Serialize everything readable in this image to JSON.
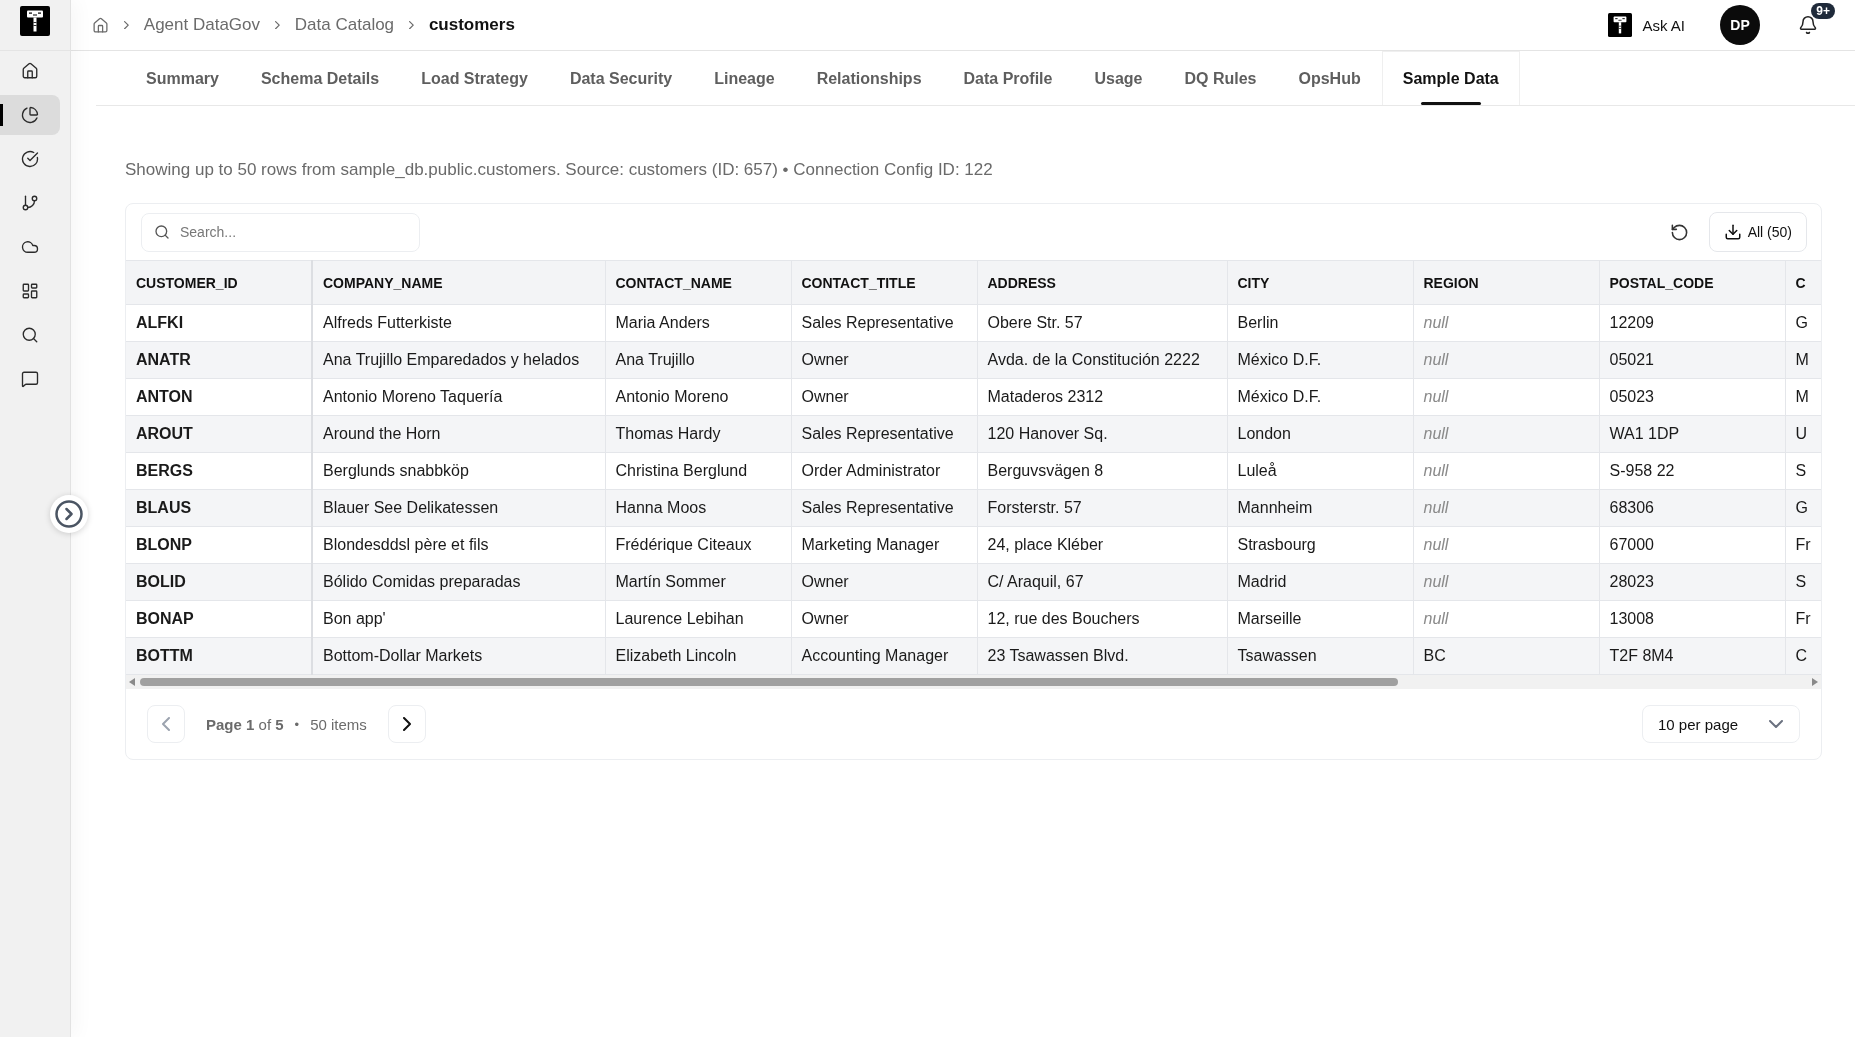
{
  "sidebar": {
    "items": [
      {
        "selected": false
      },
      {
        "selected": true
      },
      {
        "selected": false
      },
      {
        "selected": false
      },
      {
        "selected": false
      },
      {
        "selected": false
      },
      {
        "selected": false
      },
      {
        "selected": false
      }
    ]
  },
  "breadcrumb": [
    {
      "label": "Agent DataGov",
      "current": false
    },
    {
      "label": "Data Catalog",
      "current": false
    },
    {
      "label": "customers",
      "current": true
    }
  ],
  "header": {
    "ask_ai": "Ask AI",
    "avatar": "DP",
    "notifications_badge": "9+"
  },
  "tabs": [
    {
      "label": "Summary",
      "selected": false
    },
    {
      "label": "Schema Details",
      "selected": false
    },
    {
      "label": "Load Strategy",
      "selected": false
    },
    {
      "label": "Data Security",
      "selected": false
    },
    {
      "label": "Lineage",
      "selected": false
    },
    {
      "label": "Relationships",
      "selected": false
    },
    {
      "label": "Data Profile",
      "selected": false
    },
    {
      "label": "Usage",
      "selected": false
    },
    {
      "label": "DQ Rules",
      "selected": false
    },
    {
      "label": "OpsHub",
      "selected": false
    },
    {
      "label": "Sample Data",
      "selected": true
    }
  ],
  "description": "Showing up to 50 rows from sample_db.public.customers. Source: customers (ID: 657) • Connection Config ID: 122",
  "toolbar": {
    "search": {
      "placeholder": "Search..."
    },
    "export_button": "All (50)"
  },
  "table": {
    "columns": [
      "CUSTOMER_ID",
      "COMPANY_NAME",
      "CONTACT_NAME",
      "CONTACT_TITLE",
      "ADDRESS",
      "CITY",
      "REGION",
      "POSTAL_CODE",
      "C"
    ],
    "rows": [
      {
        "cells": [
          {
            "text": "ALFKI",
            "kind": "value"
          },
          {
            "text": "Alfreds Futterkiste",
            "kind": "value"
          },
          {
            "text": "Maria Anders",
            "kind": "value"
          },
          {
            "text": "Sales Representative",
            "kind": "value"
          },
          {
            "text": "Obere Str. 57",
            "kind": "value"
          },
          {
            "text": "Berlin",
            "kind": "value"
          },
          {
            "text": "null",
            "kind": "null"
          },
          {
            "text": "12209",
            "kind": "value"
          },
          {
            "text": "G",
            "kind": "value"
          }
        ]
      },
      {
        "cells": [
          {
            "text": "ANATR",
            "kind": "value"
          },
          {
            "text": "Ana Trujillo Emparedados y helados",
            "kind": "value"
          },
          {
            "text": "Ana Trujillo",
            "kind": "value"
          },
          {
            "text": "Owner",
            "kind": "value"
          },
          {
            "text": "Avda. de la Constitución 2222",
            "kind": "value"
          },
          {
            "text": "México D.F.",
            "kind": "value"
          },
          {
            "text": "null",
            "kind": "null"
          },
          {
            "text": "05021",
            "kind": "value"
          },
          {
            "text": "M",
            "kind": "value"
          }
        ]
      },
      {
        "cells": [
          {
            "text": "ANTON",
            "kind": "value"
          },
          {
            "text": "Antonio Moreno Taquería",
            "kind": "value"
          },
          {
            "text": "Antonio Moreno",
            "kind": "value"
          },
          {
            "text": "Owner",
            "kind": "value"
          },
          {
            "text": "Mataderos 2312",
            "kind": "value"
          },
          {
            "text": "México D.F.",
            "kind": "value"
          },
          {
            "text": "null",
            "kind": "null"
          },
          {
            "text": "05023",
            "kind": "value"
          },
          {
            "text": "M",
            "kind": "value"
          }
        ]
      },
      {
        "cells": [
          {
            "text": "AROUT",
            "kind": "value"
          },
          {
            "text": "Around the Horn",
            "kind": "value"
          },
          {
            "text": "Thomas Hardy",
            "kind": "value"
          },
          {
            "text": "Sales Representative",
            "kind": "value"
          },
          {
            "text": "120 Hanover Sq.",
            "kind": "value"
          },
          {
            "text": "London",
            "kind": "value"
          },
          {
            "text": "null",
            "kind": "null"
          },
          {
            "text": "WA1 1DP",
            "kind": "value"
          },
          {
            "text": "U",
            "kind": "value"
          }
        ]
      },
      {
        "cells": [
          {
            "text": "BERGS",
            "kind": "value"
          },
          {
            "text": "Berglunds snabbköp",
            "kind": "value"
          },
          {
            "text": "Christina Berglund",
            "kind": "value"
          },
          {
            "text": "Order Administrator",
            "kind": "value"
          },
          {
            "text": "Berguvsvägen 8",
            "kind": "value"
          },
          {
            "text": "Luleå",
            "kind": "value"
          },
          {
            "text": "null",
            "kind": "null"
          },
          {
            "text": "S-958 22",
            "kind": "value"
          },
          {
            "text": "S",
            "kind": "value"
          }
        ]
      },
      {
        "cells": [
          {
            "text": "BLAUS",
            "kind": "value"
          },
          {
            "text": "Blauer See Delikatessen",
            "kind": "value"
          },
          {
            "text": "Hanna Moos",
            "kind": "value"
          },
          {
            "text": "Sales Representative",
            "kind": "value"
          },
          {
            "text": "Forsterstr. 57",
            "kind": "value"
          },
          {
            "text": "Mannheim",
            "kind": "value"
          },
          {
            "text": "null",
            "kind": "null"
          },
          {
            "text": "68306",
            "kind": "value"
          },
          {
            "text": "G",
            "kind": "value"
          }
        ]
      },
      {
        "cells": [
          {
            "text": "BLONP",
            "kind": "value"
          },
          {
            "text": "Blondesddsl père et fils",
            "kind": "value"
          },
          {
            "text": "Frédérique Citeaux",
            "kind": "value"
          },
          {
            "text": "Marketing Manager",
            "kind": "value"
          },
          {
            "text": "24, place Kléber",
            "kind": "value"
          },
          {
            "text": "Strasbourg",
            "kind": "value"
          },
          {
            "text": "null",
            "kind": "null"
          },
          {
            "text": "67000",
            "kind": "value"
          },
          {
            "text": "Fr",
            "kind": "value"
          }
        ]
      },
      {
        "cells": [
          {
            "text": "BOLID",
            "kind": "value"
          },
          {
            "text": "Bólido Comidas preparadas",
            "kind": "value"
          },
          {
            "text": "Martín Sommer",
            "kind": "value"
          },
          {
            "text": "Owner",
            "kind": "value"
          },
          {
            "text": "C/ Araquil, 67",
            "kind": "value"
          },
          {
            "text": "Madrid",
            "kind": "value"
          },
          {
            "text": "null",
            "kind": "null"
          },
          {
            "text": "28023",
            "kind": "value"
          },
          {
            "text": "S",
            "kind": "value"
          }
        ]
      },
      {
        "cells": [
          {
            "text": "BONAP",
            "kind": "value"
          },
          {
            "text": "Bon app'",
            "kind": "value"
          },
          {
            "text": "Laurence Lebihan",
            "kind": "value"
          },
          {
            "text": "Owner",
            "kind": "value"
          },
          {
            "text": "12, rue des Bouchers",
            "kind": "value"
          },
          {
            "text": "Marseille",
            "kind": "value"
          },
          {
            "text": "null",
            "kind": "null"
          },
          {
            "text": "13008",
            "kind": "value"
          },
          {
            "text": "Fr",
            "kind": "value"
          }
        ]
      },
      {
        "cells": [
          {
            "text": "BOTTM",
            "kind": "value"
          },
          {
            "text": "Bottom-Dollar Markets",
            "kind": "value"
          },
          {
            "text": "Elizabeth Lincoln",
            "kind": "value"
          },
          {
            "text": "Accounting Manager",
            "kind": "value"
          },
          {
            "text": "23 Tsawassen Blvd.",
            "kind": "value"
          },
          {
            "text": "Tsawassen",
            "kind": "value"
          },
          {
            "text": "BC",
            "kind": "value"
          },
          {
            "text": "T2F 8M4",
            "kind": "value"
          },
          {
            "text": "C",
            "kind": "value"
          }
        ]
      }
    ]
  },
  "pagination": {
    "previous": {
      "disabled": true
    },
    "page_info": "**Page 1** of **5**",
    "separator": "•",
    "item_count": "50 items",
    "next": {
      "disabled": false
    },
    "per_page": "10 per page"
  }
}
